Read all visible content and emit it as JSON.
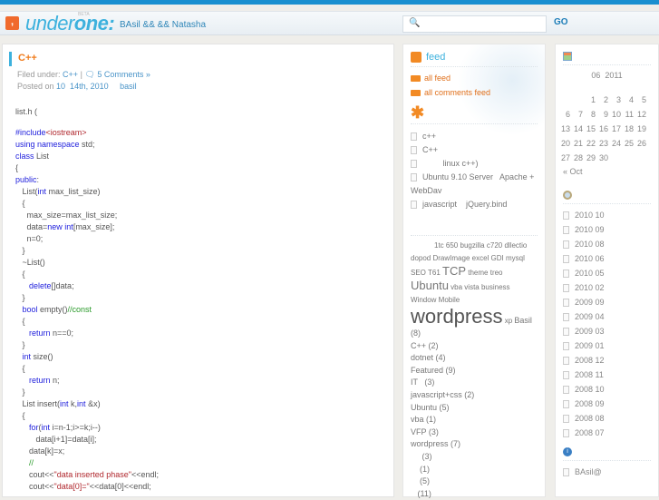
{
  "header": {
    "logo_icon": "comma-icon",
    "logo_part1": "under",
    "logo_part2": "one",
    "logo_colon": ":",
    "beta": "BETA",
    "tagline": "BAsil &&    && Natasha",
    "search_placeholder": "",
    "go": "GO"
  },
  "post": {
    "title": "C++",
    "filed_under": "Filed under:",
    "category": "C++",
    "sep": "|",
    "comments": "5 Comments »",
    "posted_on": "Posted on",
    "date": "10  14th, 2010",
    "author": "basil"
  },
  "code": [
    [
      [
        "t",
        "list.h ("
      ]
    ],
    [
      [
        "t",
        ""
      ]
    ],
    [
      [
        "kw",
        "#include"
      ],
      [
        "st",
        "<iostream>"
      ]
    ],
    [
      [
        "kw",
        "using namespace"
      ],
      [
        "t",
        " std;"
      ]
    ],
    [
      [
        "kw",
        "class"
      ],
      [
        "t",
        " List"
      ]
    ],
    [
      [
        "t",
        "{"
      ]
    ],
    [
      [
        "kw",
        "public"
      ],
      [
        "t",
        ":"
      ]
    ],
    [
      [
        "t",
        "   List("
      ],
      [
        "kw",
        "int"
      ],
      [
        "t",
        " max_list_size)"
      ]
    ],
    [
      [
        "t",
        "   {"
      ]
    ],
    [
      [
        "t",
        "     max_size=max_list_size;"
      ]
    ],
    [
      [
        "t",
        "     data="
      ],
      [
        "kw",
        "new int"
      ],
      [
        "t",
        "[max_size];"
      ]
    ],
    [
      [
        "t",
        "     n=0;"
      ]
    ],
    [
      [
        "t",
        "   }"
      ]
    ],
    [
      [
        "t",
        "   ~List()"
      ]
    ],
    [
      [
        "t",
        "   {"
      ]
    ],
    [
      [
        "t",
        "      "
      ],
      [
        "kw",
        "delete"
      ],
      [
        "t",
        "[]data;"
      ]
    ],
    [
      [
        "t",
        "   }"
      ]
    ],
    [
      [
        "t",
        "   "
      ],
      [
        "kw",
        "bool"
      ],
      [
        "t",
        " empty()"
      ],
      [
        "cm",
        "//const"
      ]
    ],
    [
      [
        "t",
        "   {"
      ]
    ],
    [
      [
        "t",
        "      "
      ],
      [
        "kw",
        "return"
      ],
      [
        "t",
        " n==0;"
      ]
    ],
    [
      [
        "t",
        "   }"
      ]
    ],
    [
      [
        "t",
        "   "
      ],
      [
        "kw",
        "int"
      ],
      [
        "t",
        " size()"
      ]
    ],
    [
      [
        "t",
        "   {"
      ]
    ],
    [
      [
        "t",
        "      "
      ],
      [
        "kw",
        "return"
      ],
      [
        "t",
        " n;"
      ]
    ],
    [
      [
        "t",
        "   }"
      ]
    ],
    [
      [
        "t",
        "   List insert("
      ],
      [
        "kw",
        "int"
      ],
      [
        "t",
        " k,"
      ],
      [
        "kw",
        "int"
      ],
      [
        "t",
        " &x)"
      ]
    ],
    [
      [
        "t",
        "   {"
      ]
    ],
    [
      [
        "t",
        "      "
      ],
      [
        "kw",
        "for"
      ],
      [
        "t",
        "("
      ],
      [
        "kw",
        "int"
      ],
      [
        "t",
        " i=n-1;i>=k;i--)"
      ]
    ],
    [
      [
        "t",
        "         data[i+1]=data[i];"
      ]
    ],
    [
      [
        "t",
        "      data[k]=x;"
      ]
    ],
    [
      [
        "t",
        "      "
      ],
      [
        "cm",
        "//"
      ]
    ],
    [
      [
        "t",
        "      cout<<"
      ],
      [
        "st",
        "\"data inserted phase\""
      ],
      [
        "t",
        "<<endl;"
      ]
    ],
    [
      [
        "t",
        "      cout<<"
      ],
      [
        "st",
        "\"data[0]=\""
      ],
      [
        "t",
        "<<data[0]<<endl;"
      ]
    ]
  ],
  "feed": {
    "title": "feed",
    "all_feed": "all feed",
    "all_comments": "all comments feed"
  },
  "recent": {
    "icon": "asterisk-icon",
    "items": [
      "c++",
      "C++",
      "         linux c++)",
      "Ubuntu 9.10 Server   Apache + WebDav",
      "javascript    jQuery.bind"
    ]
  },
  "cloud": [
    [
      "1tc",
      8
    ],
    [
      "650",
      8
    ],
    [
      "bugzilla",
      8
    ],
    [
      "c720",
      8
    ],
    [
      "dllectio",
      8
    ],
    [
      "dopod",
      8
    ],
    [
      "DrawImage",
      8
    ],
    [
      "excel",
      8
    ],
    [
      "GDI",
      8
    ],
    [
      "mysql",
      8
    ],
    [
      "SEO",
      8
    ],
    [
      "T61",
      8
    ],
    [
      "TCP",
      13
    ],
    [
      "theme",
      8
    ],
    [
      "treo",
      8
    ],
    [
      "Ubuntu",
      13
    ],
    [
      "vba",
      8
    ],
    [
      "vista",
      8
    ],
    [
      "business",
      8
    ],
    [
      "Window Mobile",
      8
    ],
    [
      "wordpress",
      22
    ],
    [
      "xp",
      8
    ],
    [
      "Basil",
      9
    ]
  ],
  "categories": [
    "(8)",
    "C++ (2)",
    "dotnet (4)",
    "Featured (9)",
    "IT   (3)",
    "javascript+css (2)",
    "Ubuntu (5)",
    "vba (1)",
    "VFP (3)",
    "wordpress (7)",
    "     (3)",
    "    (1)",
    "    (5)",
    "   (11)"
  ],
  "calendar": {
    "caption": "06  2011",
    "weeks": [
      [
        "",
        "",
        "",
        "1",
        "2",
        "3",
        "4",
        "5"
      ],
      [
        "6",
        "7",
        "8",
        "9",
        "10",
        "11",
        "12"
      ],
      [
        "13",
        "14",
        "15",
        "16",
        "17",
        "18",
        "19"
      ],
      [
        "20",
        "21",
        "22",
        "23",
        "24",
        "25",
        "26"
      ],
      [
        "27",
        "28",
        "29",
        "30"
      ]
    ],
    "prev": "« Oct"
  },
  "archives": [
    "2010 10",
    "2010 09",
    "2010 08",
    "2010 06",
    "2010 05",
    "2010 02",
    "2009 09",
    "2009 04",
    "2009 03",
    "2009 01",
    "2008 12",
    "2008 11",
    "2008 10",
    "2008 09",
    "2008 08",
    "2008 07"
  ],
  "info": {
    "items": [
      "BAsil@"
    ]
  }
}
